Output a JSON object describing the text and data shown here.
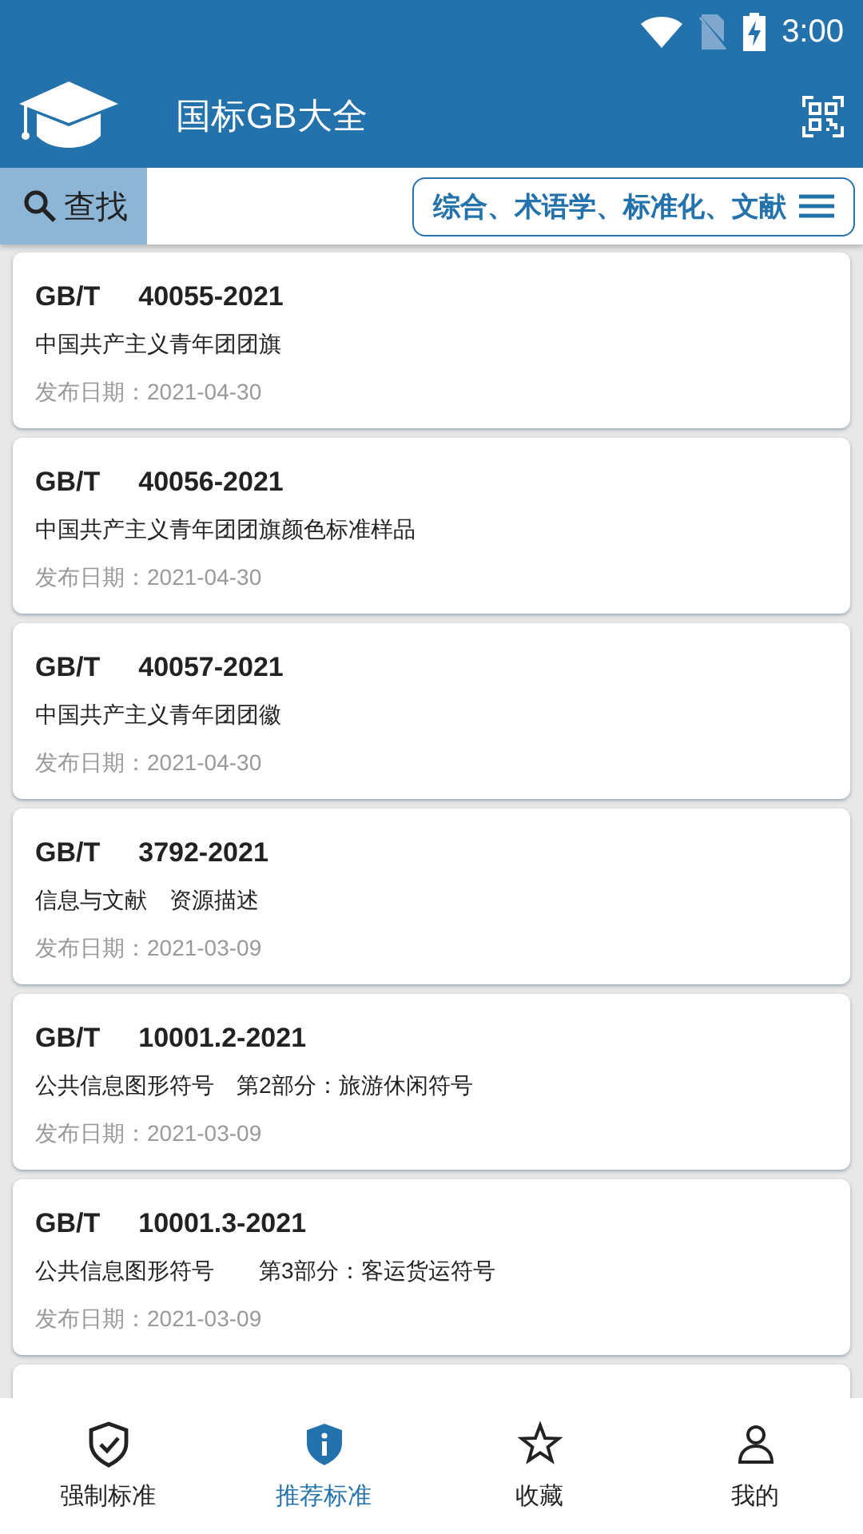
{
  "status_bar": {
    "time": "3:00"
  },
  "app_bar": {
    "title": "国标GB大全"
  },
  "search": {
    "label": "查找"
  },
  "category_filter": {
    "label": "综合、术语学、标准化、文献"
  },
  "standards": [
    {
      "prefix": "GB/T",
      "number": "40055-2021",
      "title": "中国共产主义青年团团旗",
      "date": "发布日期：2021-04-30"
    },
    {
      "prefix": "GB/T",
      "number": "40056-2021",
      "title": "中国共产主义青年团团旗颜色标准样品",
      "date": "发布日期：2021-04-30"
    },
    {
      "prefix": "GB/T",
      "number": "40057-2021",
      "title": "中国共产主义青年团团徽",
      "date": "发布日期：2021-04-30"
    },
    {
      "prefix": "GB/T",
      "number": "3792-2021",
      "title": "信息与文献　资源描述",
      "date": "发布日期：2021-03-09"
    },
    {
      "prefix": "GB/T",
      "number": "10001.2-2021",
      "title": "公共信息图形符号　第2部分：旅游休闲符号",
      "date": "发布日期：2021-03-09"
    },
    {
      "prefix": "GB/T",
      "number": "10001.3-2021",
      "title": "公共信息图形符号　　第3部分：客运货运符号",
      "date": "发布日期：2021-03-09"
    }
  ],
  "more_below": true,
  "bottom_nav": [
    {
      "kind": "shield-check",
      "label": "强制标准",
      "selected": false
    },
    {
      "kind": "shield-info",
      "label": "推荐标准",
      "selected": true
    },
    {
      "kind": "star",
      "label": "收藏",
      "selected": false
    },
    {
      "kind": "person",
      "label": "我的",
      "selected": false
    }
  ]
}
